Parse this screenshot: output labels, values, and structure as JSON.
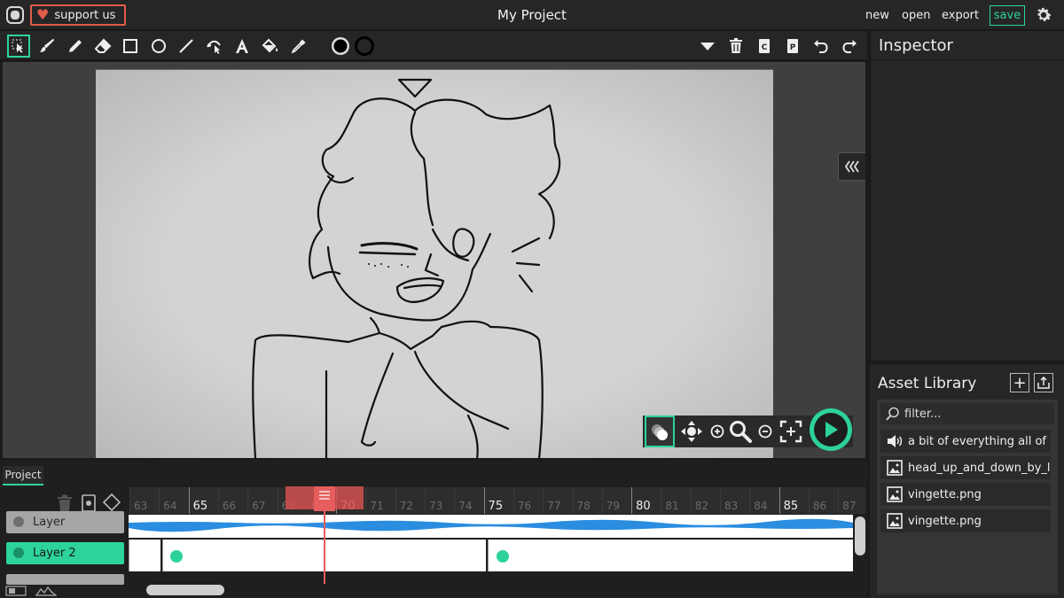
{
  "topbar": {
    "support_label": "support us",
    "title": "My Project",
    "menu": {
      "new": "new",
      "open": "open",
      "export": "export",
      "save": "save"
    }
  },
  "toolbar": {
    "tools": [
      "select-icon",
      "brush-icon",
      "pencil-icon",
      "eraser-icon",
      "rectangle-icon",
      "ellipse-icon",
      "line-icon",
      "path-edit-icon",
      "text-icon",
      "fill-bucket-icon",
      "eyedropper-icon"
    ],
    "active_tool": "select-icon",
    "stroke_color": "#000000",
    "fill_color": "#000000",
    "right_tools": [
      "dropdown-icon",
      "delete-icon",
      "copy-icon",
      "paste-icon",
      "undo-icon",
      "redo-icon"
    ]
  },
  "inspector": {
    "title": "Inspector"
  },
  "asset_library": {
    "title": "Asset Library",
    "filter_placeholder": "filter...",
    "assets": [
      {
        "type": "sound-icon",
        "name": "a bit of everything all of"
      },
      {
        "type": "image-icon",
        "name": "head_up_and_down_by_l"
      },
      {
        "type": "image-icon",
        "name": "vingette.png"
      },
      {
        "type": "image-icon",
        "name": "vingette.png"
      }
    ]
  },
  "timeline": {
    "tab": "Project",
    "ruler": [
      "63",
      "64",
      "65",
      "66",
      "67",
      "68",
      "69",
      "70",
      "71",
      "72",
      "73",
      "74",
      "75",
      "76",
      "77",
      "78",
      "79",
      "80",
      "81",
      "82",
      "83",
      "84",
      "85",
      "86",
      "87"
    ],
    "major_labels": [
      "65",
      "70",
      "75",
      "80",
      "85"
    ],
    "current_frame": 69,
    "layers": [
      {
        "name": "Layer"
      },
      {
        "name": "Layer 2"
      }
    ]
  },
  "colors": {
    "accent": "#2ed39a",
    "support": "#e25c4a",
    "playhead": "#e65d5d"
  }
}
